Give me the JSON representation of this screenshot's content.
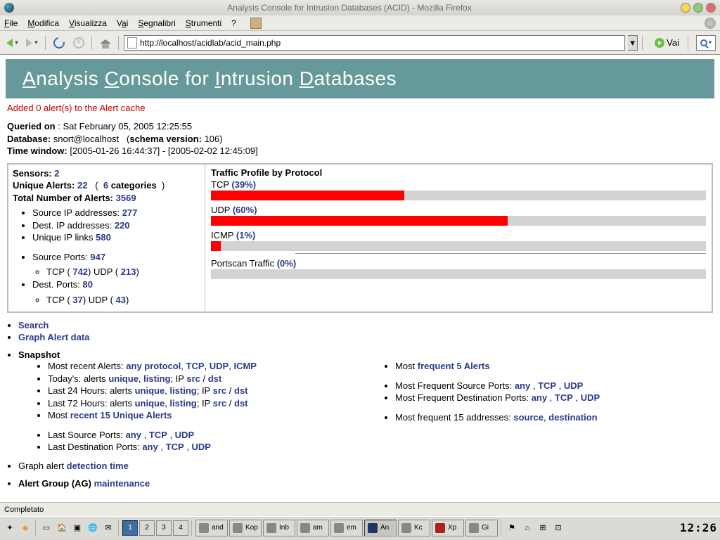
{
  "window": {
    "title": "Analysis Console for Intrusion Databases (ACID) - Mozilla Firefox"
  },
  "menu": {
    "file": "File",
    "edit": "Modifica",
    "view": "Visualizza",
    "go": "Vai",
    "bookmarks": "Segnalibri",
    "tools": "Strumenti",
    "help": "?"
  },
  "nav": {
    "url": "http://localhost/acidlab/acid_main.php",
    "go_label": "Vai"
  },
  "header": {
    "w1": "Analysis",
    "w2": "Console",
    "for": "for",
    "w3": "Intrusion",
    "w4": "Databases"
  },
  "status_msg": "Added 0 alert(s) to the Alert cache",
  "queried": {
    "label": "Queried on",
    "value": ": Sat February 05, 2005 12:25:55"
  },
  "database": {
    "label": "Database:",
    "value": "snort@localhost",
    "schema_label": "schema version:",
    "schema": "106"
  },
  "timewin": {
    "label": "Time window:",
    "value": "[2005-01-26 16:44:37] - [2005-02-02 12:45:09]"
  },
  "left": {
    "sensors_label": "Sensors:",
    "sensors": "2",
    "ualerts_label": "Unique Alerts:",
    "ualerts": "22",
    "categories": "6",
    "cat_word": "categories",
    "total_label": "Total Number of Alerts:",
    "total": "3569",
    "src_ip_l": "Source IP addresses:",
    "src_ip": "277",
    "dst_ip_l": "Dest. IP addresses:",
    "dst_ip": "220",
    "uip_l": "Unique IP links",
    "uip": "580",
    "sports_l": "Source Ports:",
    "sports": "947",
    "sports_tcp_l": "TCP (",
    "sports_tcp": "742",
    "sports_udp_l": ")  UDP (",
    "sports_udp": "213",
    "close": ")",
    "dports_l": "Dest. Ports:",
    "dports": "80",
    "dports_tcp": "37",
    "dports_udp": "43"
  },
  "proto": {
    "title": "Traffic Profile by Protocol",
    "tcp_l": "TCP",
    "tcp_p": "(39%)",
    "udp_l": "UDP",
    "udp_p": "(60%)",
    "icmp_l": "ICMP",
    "icmp_p": "(1%)",
    "scan_l": "Portscan Traffic",
    "scan_p": "(0%)"
  },
  "chart_data": {
    "type": "bar",
    "title": "Traffic Profile by Protocol",
    "categories": [
      "TCP",
      "UDP",
      "ICMP",
      "Portscan Traffic"
    ],
    "values": [
      39,
      60,
      1,
      0
    ],
    "xlabel": "",
    "ylabel": "%",
    "ylim": [
      0,
      100
    ]
  },
  "links": {
    "search": "Search",
    "graph": "Graph Alert data",
    "snapshot": "Snapshot",
    "recent_l": "Most recent Alerts:",
    "any": "any protocol",
    "tcp": "TCP",
    "udp": "UDP",
    "icmp": "ICMP",
    "today_l": "Today's: alerts",
    "unique": "unique",
    "listing": "listing",
    "ip": "IP",
    "src": "src",
    "dst": "dst",
    "last24": "Last 24 Hours: alerts",
    "last72": "Last 72 Hours: alerts",
    "recent15": "Most",
    "recent15b": "recent 15 Unique Alerts",
    "lsrc_l": "Last Source Ports:",
    "ldst_l": "Last Destination Ports:",
    "anyv": "any",
    "freq5a": "Most",
    "freq5b": "frequent 5 Alerts",
    "freqsrc_l": "Most Frequent Source Ports:",
    "freqdst_l": "Most Frequent Destination Ports:",
    "freqaddr_l": "Most frequent 15 addresses:",
    "source": "source",
    "destination": "destination",
    "detect_l": "Graph alert",
    "detect": "detection time",
    "ag_l": "Alert Group (AG)",
    "ag": "maintenance"
  },
  "statusbar": {
    "text": "Completato"
  },
  "taskbar": {
    "desks": [
      "1",
      "2",
      "3",
      "4"
    ],
    "tasks": [
      "and",
      "Kop",
      "Inb",
      "am",
      "em",
      "An",
      "Kc",
      "Xp",
      "Gi"
    ],
    "clock": "12:26"
  }
}
